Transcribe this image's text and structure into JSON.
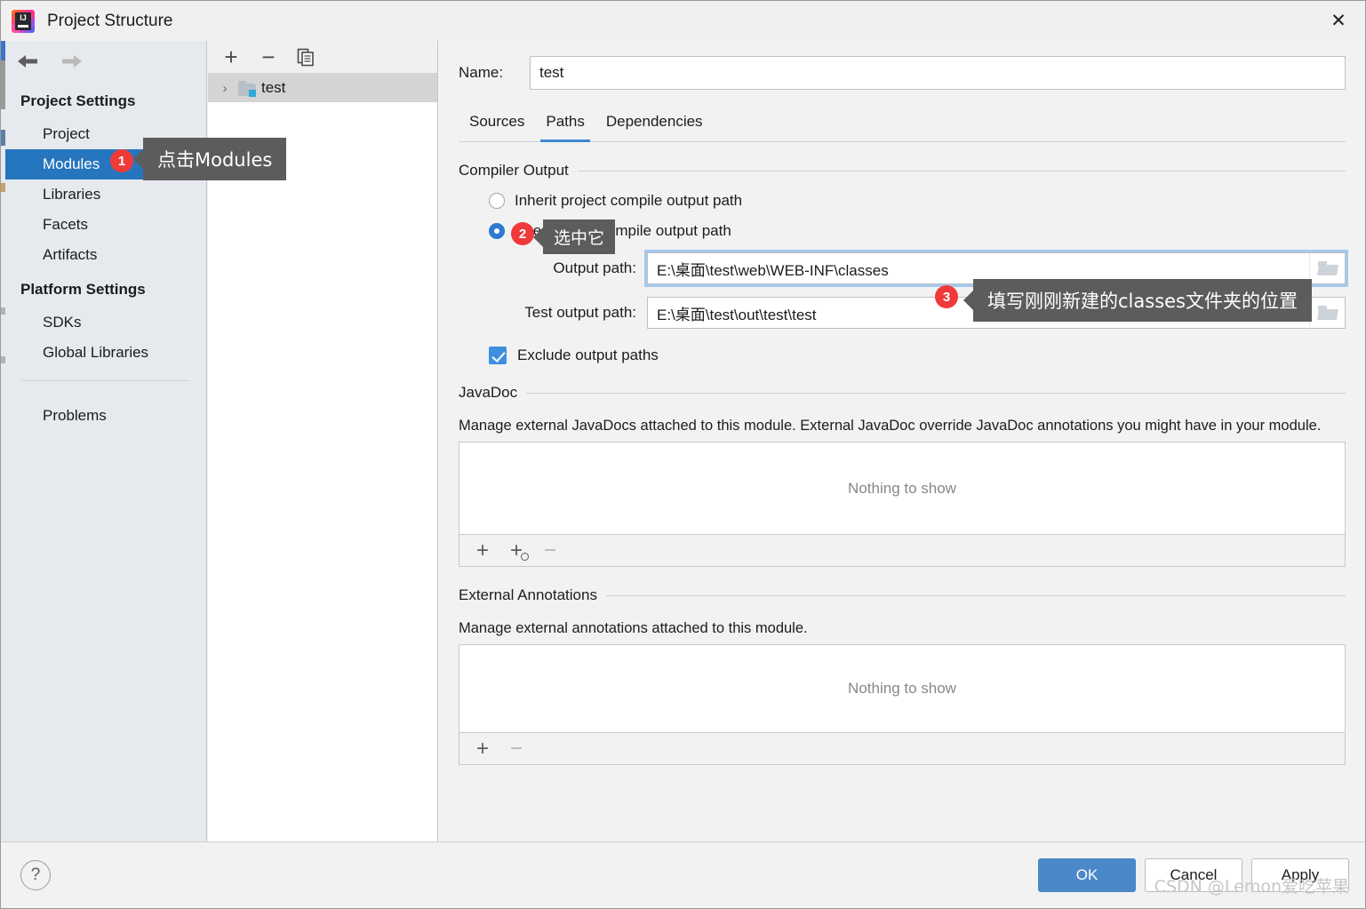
{
  "window": {
    "title": "Project Structure",
    "logo_text": "IJ",
    "close_icon": "close-icon"
  },
  "sidebar": {
    "back_icon": "arrow-left-icon",
    "forward_icon": "arrow-right-icon",
    "groups": [
      {
        "title": "Project Settings",
        "items": [
          {
            "label": "Project",
            "selected": false
          },
          {
            "label": "Modules",
            "selected": true
          },
          {
            "label": "Libraries",
            "selected": false
          },
          {
            "label": "Facets",
            "selected": false
          },
          {
            "label": "Artifacts",
            "selected": false
          }
        ]
      },
      {
        "title": "Platform Settings",
        "items": [
          {
            "label": "SDKs",
            "selected": false
          },
          {
            "label": "Global Libraries",
            "selected": false
          }
        ]
      }
    ],
    "problems_label": "Problems"
  },
  "tree": {
    "toolbar": {
      "add_label": "+",
      "remove_label": "−",
      "copy_icon": "copy-icon"
    },
    "rows": [
      {
        "label": "test",
        "chevron": "›",
        "icon": "module-folder-icon",
        "selected": true
      }
    ]
  },
  "main": {
    "name_label": "Name:",
    "name_value": "test",
    "tabs": [
      {
        "label": "Sources",
        "active": false
      },
      {
        "label": "Paths",
        "active": true
      },
      {
        "label": "Dependencies",
        "active": false
      }
    ],
    "compiler_output": {
      "section_title": "Compiler Output",
      "inherit_label": "Inherit project compile output path",
      "inherit_checked": false,
      "use_module_label": "Use module compile output path",
      "use_module_checked": true,
      "output_path_label": "Output path:",
      "output_path_value": "E:\\桌面\\test\\web\\WEB-INF\\classes",
      "test_output_path_label": "Test output path:",
      "test_output_path_value": "E:\\桌面\\test\\out\\test\\test",
      "exclude_label": "Exclude output paths",
      "exclude_checked": true,
      "browse_icon": "folder-browse-icon"
    },
    "javadoc": {
      "section_title": "JavaDoc",
      "description": "Manage external JavaDocs attached to this module. External JavaDoc override JavaDoc annotations you might have in your module.",
      "empty_text": "Nothing to show",
      "toolbar": {
        "add_label": "+",
        "add_url_icon": "add-url-icon",
        "remove_label": "−"
      }
    },
    "external_annotations": {
      "section_title": "External Annotations",
      "description": "Manage external annotations attached to this module.",
      "empty_text": "Nothing to show",
      "toolbar": {
        "add_label": "+",
        "remove_label": "−"
      }
    }
  },
  "footer": {
    "help_label": "?",
    "ok_label": "OK",
    "cancel_label": "Cancel",
    "apply_label": "Apply"
  },
  "annotations": [
    {
      "number": "1",
      "text": "点击Modules"
    },
    {
      "number": "2",
      "text": "选中它"
    },
    {
      "number": "3",
      "text": "填写刚刚新建的classes文件夹的位置"
    }
  ],
  "watermark": "CSDN @Lemon爱吃苹果",
  "colors": {
    "accent": "#2675bf",
    "primary_button": "#4a88c7",
    "badge": "#f03a3a",
    "callout": "#5c5c5c",
    "tab_underline": "#3f87d6",
    "checkbox": "#3f8fe0"
  }
}
